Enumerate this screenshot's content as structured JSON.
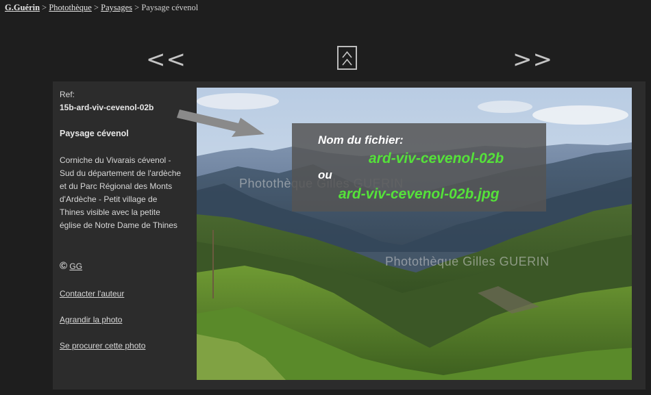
{
  "breadcrumb": {
    "home": "G.Guérin",
    "separator": ">",
    "photo_library": "Photothèque",
    "category": "Paysages",
    "current": "Paysage cévenol"
  },
  "navigation": {
    "prev": "<<",
    "next": ">>",
    "up_icon": "double-chevron-up-icon"
  },
  "info": {
    "ref_label": "Ref:",
    "ref_value": "15b-ard-viv-cevenol-02b",
    "title": "Paysage cévenol",
    "description": "Corniche du Vivarais cévenol - Sud du département de l'ardèche et du Parc Régional des Monts d'Ardèche - Petit village de Thines visible avec la petite église de Notre Dame de Thines",
    "copyright_symbol": "©",
    "copyright_link": "GG",
    "contact_link": "Contacter l'auteur",
    "enlarge_link": "Agrandir la photo",
    "buy_link": "Se procurer cette photo"
  },
  "photo": {
    "watermark_1": "Photothèque Gilles GUERIN",
    "watermark_2": "Photothèque Gilles GUERIN"
  },
  "overlay": {
    "label": "Nom du fichier:",
    "filename": "ard-viv-cevenol-02b",
    "or": "ou",
    "filename_ext": "ard-viv-cevenol-02b.jpg"
  },
  "colors": {
    "background": "#1e1e1e",
    "panel": "#2c2c2c",
    "filename_green": "#55e23a"
  }
}
